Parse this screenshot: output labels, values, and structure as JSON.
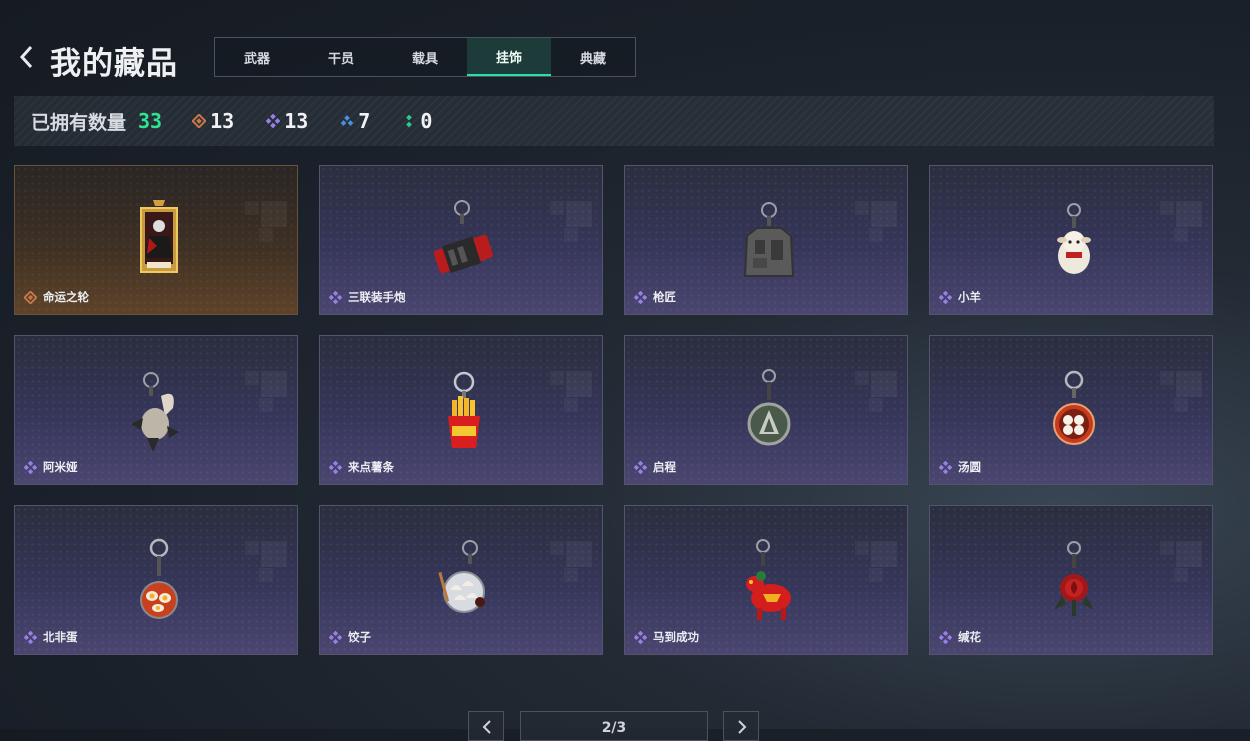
{
  "header": {
    "title": "我的藏品"
  },
  "tabs": [
    {
      "label": "武器",
      "active": false
    },
    {
      "label": "干员",
      "active": false
    },
    {
      "label": "载具",
      "active": false
    },
    {
      "label": "挂饰",
      "active": true
    },
    {
      "label": "典藏",
      "active": false
    }
  ],
  "stats": {
    "owned_label": "已拥有数量",
    "owned_total": "33",
    "counts": [
      {
        "rarity": "gold",
        "icon": "gold-diamond-icon",
        "value": "13",
        "color": "#c9774a"
      },
      {
        "rarity": "purple",
        "icon": "purple-diamond-icon",
        "value": "13",
        "color": "#9b7fe6"
      },
      {
        "rarity": "blue",
        "icon": "blue-diamond-icon",
        "value": "7",
        "color": "#4a8fe0"
      },
      {
        "rarity": "green",
        "icon": "green-dots-icon",
        "value": "0",
        "color": "#2fc98a"
      }
    ]
  },
  "items": [
    {
      "name": "命运之轮",
      "rarity": "gold",
      "charm": "fate-wheel-card-charm"
    },
    {
      "name": "三联装手炮",
      "rarity": "purple",
      "charm": "hand-cannon-charm"
    },
    {
      "name": "枪匠",
      "rarity": "purple",
      "charm": "gunsmith-vest-charm"
    },
    {
      "name": "小羊",
      "rarity": "purple",
      "charm": "lamb-charm"
    },
    {
      "name": "阿米娅",
      "rarity": "purple",
      "charm": "amiya-rabbit-charm"
    },
    {
      "name": "来点薯条",
      "rarity": "purple",
      "charm": "fries-charm"
    },
    {
      "name": "启程",
      "rarity": "purple",
      "charm": "departure-medal-charm"
    },
    {
      "name": "汤圆",
      "rarity": "purple",
      "charm": "tangyuan-bowl-charm"
    },
    {
      "name": "北非蛋",
      "rarity": "purple",
      "charm": "shakshuka-pan-charm"
    },
    {
      "name": "饺子",
      "rarity": "purple",
      "charm": "dumplings-plate-charm"
    },
    {
      "name": "马到成功",
      "rarity": "purple",
      "charm": "red-horse-charm"
    },
    {
      "name": "缄花",
      "rarity": "purple",
      "charm": "rose-charm"
    }
  ],
  "pagination": {
    "page": "2/3"
  }
}
